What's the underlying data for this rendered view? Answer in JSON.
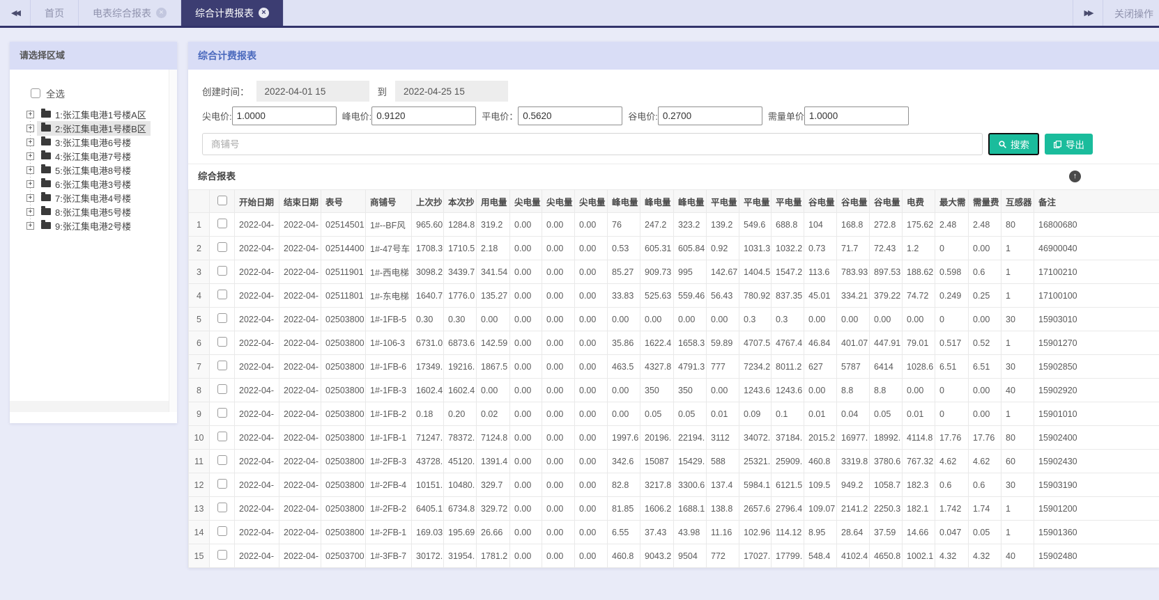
{
  "icons": {
    "tabs_scroll_left": "◀◀",
    "tabs_scroll_right": "▶▶",
    "tab_close": "×",
    "tree_expand": "+",
    "collapse_up": "↑"
  },
  "tab_bar": {
    "tabs": [
      {
        "label": "首页",
        "closable": false,
        "active": false
      },
      {
        "label": "电表综合报表",
        "closable": true,
        "active": false
      },
      {
        "label": "综合计费报表",
        "closable": true,
        "active": true
      }
    ],
    "right_menu_label": "关闭操作"
  },
  "sidebar": {
    "title": "请选择区域",
    "select_all_label": "全选",
    "tree": [
      {
        "label": "1:张江集电港1号楼A区",
        "selected": false
      },
      {
        "label": "2:张江集电港1号楼B区",
        "selected": true
      },
      {
        "label": "3:张江集电港6号楼",
        "selected": false
      },
      {
        "label": "4:张江集电港7号楼",
        "selected": false
      },
      {
        "label": "5:张江集电港8号楼",
        "selected": false
      },
      {
        "label": "6:张江集电港3号楼",
        "selected": false
      },
      {
        "label": "7:张江集电港4号楼",
        "selected": false
      },
      {
        "label": "8:张江集电港5号楼",
        "selected": false
      },
      {
        "label": "9:张江集电港2号楼",
        "selected": false
      }
    ]
  },
  "main": {
    "title": "综合计费报表",
    "filters": {
      "created_label": "创建时间：",
      "date_from": "2022-04-01 15",
      "to_label": "到",
      "date_to": "2022-04-25 15",
      "prices": [
        {
          "label": "尖电价:",
          "value": "1.0000"
        },
        {
          "label": "峰电价:",
          "value": "0.9120"
        },
        {
          "label": "平电价：",
          "value": "0.5620"
        },
        {
          "label": "谷电价:",
          "value": "0.2700"
        },
        {
          "label": "需量单价",
          "value": "1.0000"
        }
      ],
      "shop_placeholder": "商铺号",
      "search_label": "搜索",
      "export_label": "导出"
    },
    "table": {
      "section_title": "综合报表",
      "headers": [
        "开始日期",
        "结束日期",
        "表号",
        "商铺号",
        "上次抄",
        "本次抄",
        "用电量",
        "尖电量",
        "尖电量",
        "尖电量",
        "峰电量",
        "峰电量",
        "峰电量",
        "平电量",
        "平电量",
        "平电量",
        "谷电量",
        "谷电量",
        "谷电量",
        "电费",
        "最大需",
        "需量费",
        "互感器",
        "备注"
      ],
      "rows": [
        {
          "num": 1,
          "cells": [
            "2022-04-",
            "2022-04-",
            "02514501",
            "1#--BF风",
            "965.60",
            "1284.8",
            "319.2",
            "0.00",
            "0.00",
            "0.00",
            "76",
            "247.2",
            "323.2",
            "139.2",
            "549.6",
            "688.8",
            "104",
            "168.8",
            "272.8",
            "175.62",
            "2.48",
            "2.48",
            "80",
            "16800680"
          ]
        },
        {
          "num": 2,
          "cells": [
            "2022-04-",
            "2022-04-",
            "02514400",
            "1#-47号车",
            "1708.3",
            "1710.5",
            "2.18",
            "0.00",
            "0.00",
            "0.00",
            "0.53",
            "605.31",
            "605.84",
            "0.92",
            "1031.3",
            "1032.2",
            "0.73",
            "71.7",
            "72.43",
            "1.2",
            "0",
            "0.00",
            "1",
            "46900040"
          ]
        },
        {
          "num": 3,
          "cells": [
            "2022-04-",
            "2022-04-",
            "02511901",
            "1#-西电梯",
            "3098.2",
            "3439.7",
            "341.54",
            "0.00",
            "0.00",
            "0.00",
            "85.27",
            "909.73",
            "995",
            "142.67",
            "1404.5",
            "1547.2",
            "113.6",
            "783.93",
            "897.53",
            "188.62",
            "0.598",
            "0.6",
            "1",
            "17100210"
          ]
        },
        {
          "num": 4,
          "cells": [
            "2022-04-",
            "2022-04-",
            "02511801",
            "1#-东电梯",
            "1640.7",
            "1776.0",
            "135.27",
            "0.00",
            "0.00",
            "0.00",
            "33.83",
            "525.63",
            "559.46",
            "56.43",
            "780.92",
            "837.35",
            "45.01",
            "334.21",
            "379.22",
            "74.72",
            "0.249",
            "0.25",
            "1",
            "17100100"
          ]
        },
        {
          "num": 5,
          "cells": [
            "2022-04-",
            "2022-04-",
            "02503800",
            "1#-1FB-5",
            "0.30",
            "0.30",
            "0.00",
            "0.00",
            "0.00",
            "0.00",
            "0.00",
            "0.00",
            "0.00",
            "0.00",
            "0.3",
            "0.3",
            "0.00",
            "0.00",
            "0.00",
            "0.00",
            "0",
            "0.00",
            "30",
            "15903010"
          ]
        },
        {
          "num": 6,
          "cells": [
            "2022-04-",
            "2022-04-",
            "02503800",
            "1#-106-3",
            "6731.0",
            "6873.6",
            "142.59",
            "0.00",
            "0.00",
            "0.00",
            "35.86",
            "1622.4",
            "1658.3",
            "59.89",
            "4707.5",
            "4767.4",
            "46.84",
            "401.07",
            "447.91",
            "79.01",
            "0.517",
            "0.52",
            "1",
            "15901270"
          ]
        },
        {
          "num": 7,
          "cells": [
            "2022-04-",
            "2022-04-",
            "02503800",
            "1#-1FB-6",
            "17349.",
            "19216.",
            "1867.5",
            "0.00",
            "0.00",
            "0.00",
            "463.5",
            "4327.8",
            "4791.3",
            "777",
            "7234.2",
            "8011.2",
            "627",
            "5787",
            "6414",
            "1028.6",
            "6.51",
            "6.51",
            "30",
            "15902850"
          ]
        },
        {
          "num": 8,
          "cells": [
            "2022-04-",
            "2022-04-",
            "02503800",
            "1#-1FB-3",
            "1602.4",
            "1602.4",
            "0.00",
            "0.00",
            "0.00",
            "0.00",
            "0.00",
            "350",
            "350",
            "0.00",
            "1243.6",
            "1243.6",
            "0.00",
            "8.8",
            "8.8",
            "0.00",
            "0",
            "0.00",
            "40",
            "15902920"
          ]
        },
        {
          "num": 9,
          "cells": [
            "2022-04-",
            "2022-04-",
            "02503800",
            "1#-1FB-2",
            "0.18",
            "0.20",
            "0.02",
            "0.00",
            "0.00",
            "0.00",
            "0.00",
            "0.05",
            "0.05",
            "0.01",
            "0.09",
            "0.1",
            "0.01",
            "0.04",
            "0.05",
            "0.01",
            "0",
            "0.00",
            "1",
            "15901010"
          ]
        },
        {
          "num": 10,
          "cells": [
            "2022-04-",
            "2022-04-",
            "02503800",
            "1#-1FB-1",
            "71247.",
            "78372.",
            "7124.8",
            "0.00",
            "0.00",
            "0.00",
            "1997.6",
            "20196.",
            "22194.",
            "3112",
            "34072.",
            "37184.",
            "2015.2",
            "16977.",
            "18992.",
            "4114.8",
            "17.76",
            "17.76",
            "80",
            "15902400"
          ]
        },
        {
          "num": 11,
          "cells": [
            "2022-04-",
            "2022-04-",
            "02503800",
            "1#-2FB-3",
            "43728.",
            "45120.",
            "1391.4",
            "0.00",
            "0.00",
            "0.00",
            "342.6",
            "15087",
            "15429.",
            "588",
            "25321.",
            "25909.",
            "460.8",
            "3319.8",
            "3780.6",
            "767.32",
            "4.62",
            "4.62",
            "60",
            "15902430"
          ]
        },
        {
          "num": 12,
          "cells": [
            "2022-04-",
            "2022-04-",
            "02503800",
            "1#-2FB-4",
            "10151.",
            "10480.",
            "329.7",
            "0.00",
            "0.00",
            "0.00",
            "82.8",
            "3217.8",
            "3300.6",
            "137.4",
            "5984.1",
            "6121.5",
            "109.5",
            "949.2",
            "1058.7",
            "182.3",
            "0.6",
            "0.6",
            "30",
            "15903190"
          ]
        },
        {
          "num": 13,
          "cells": [
            "2022-04-",
            "2022-04-",
            "02503800",
            "1#-2FB-2",
            "6405.1",
            "6734.8",
            "329.72",
            "0.00",
            "0.00",
            "0.00",
            "81.85",
            "1606.2",
            "1688.1",
            "138.8",
            "2657.6",
            "2796.4",
            "109.07",
            "2141.2",
            "2250.3",
            "182.1",
            "1.742",
            "1.74",
            "1",
            "15901200"
          ]
        },
        {
          "num": 14,
          "cells": [
            "2022-04-",
            "2022-04-",
            "02503800",
            "1#-2FB-1",
            "169.03",
            "195.69",
            "26.66",
            "0.00",
            "0.00",
            "0.00",
            "6.55",
            "37.43",
            "43.98",
            "11.16",
            "102.96",
            "114.12",
            "8.95",
            "28.64",
            "37.59",
            "14.66",
            "0.047",
            "0.05",
            "1",
            "15901360"
          ]
        },
        {
          "num": 15,
          "cells": [
            "2022-04-",
            "2022-04-",
            "02503700",
            "1#-3FB-7",
            "30172.",
            "31954.",
            "1781.2",
            "0.00",
            "0.00",
            "0.00",
            "460.8",
            "9043.2",
            "9504",
            "772",
            "17027.",
            "17799.",
            "548.4",
            "4102.4",
            "4650.8",
            "1002.1",
            "4.32",
            "4.32",
            "40",
            "15902480"
          ]
        }
      ]
    }
  }
}
